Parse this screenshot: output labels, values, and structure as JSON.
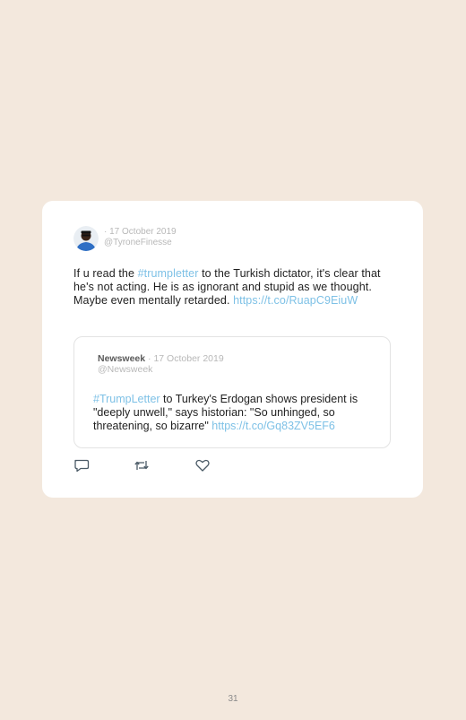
{
  "tweet": {
    "date": "· 17 October 2019",
    "handle": "@TyroneFinesse",
    "text_before": "If u read the ",
    "hashtag": "#trumpletter",
    "text_after": " to the Turkish dictator, it's clear that he's not acting. He is as ignorant and stupid as we thought. Maybe even mentally retarded. ",
    "link": "https://t.co/RuapC9EiuW"
  },
  "quoted": {
    "name": "Newsweek",
    "date": " · 17 October 2019",
    "handle": "@Newsweek",
    "hashtag": "#TrumpLetter",
    "text": " to Turkey's Erdogan shows president is \"deeply unwell,\" says historian: \"So unhinged, so threatening, so bizarre\" ",
    "link": "https://t.co/Gq83ZV5EF6"
  },
  "actions": [
    "reply-icon",
    "retweet-icon",
    "like-icon"
  ],
  "page": {
    "number": "31"
  },
  "colors": {
    "background": "#f3e8dd",
    "link": "#7ec1e6",
    "card": "#ffffff"
  }
}
